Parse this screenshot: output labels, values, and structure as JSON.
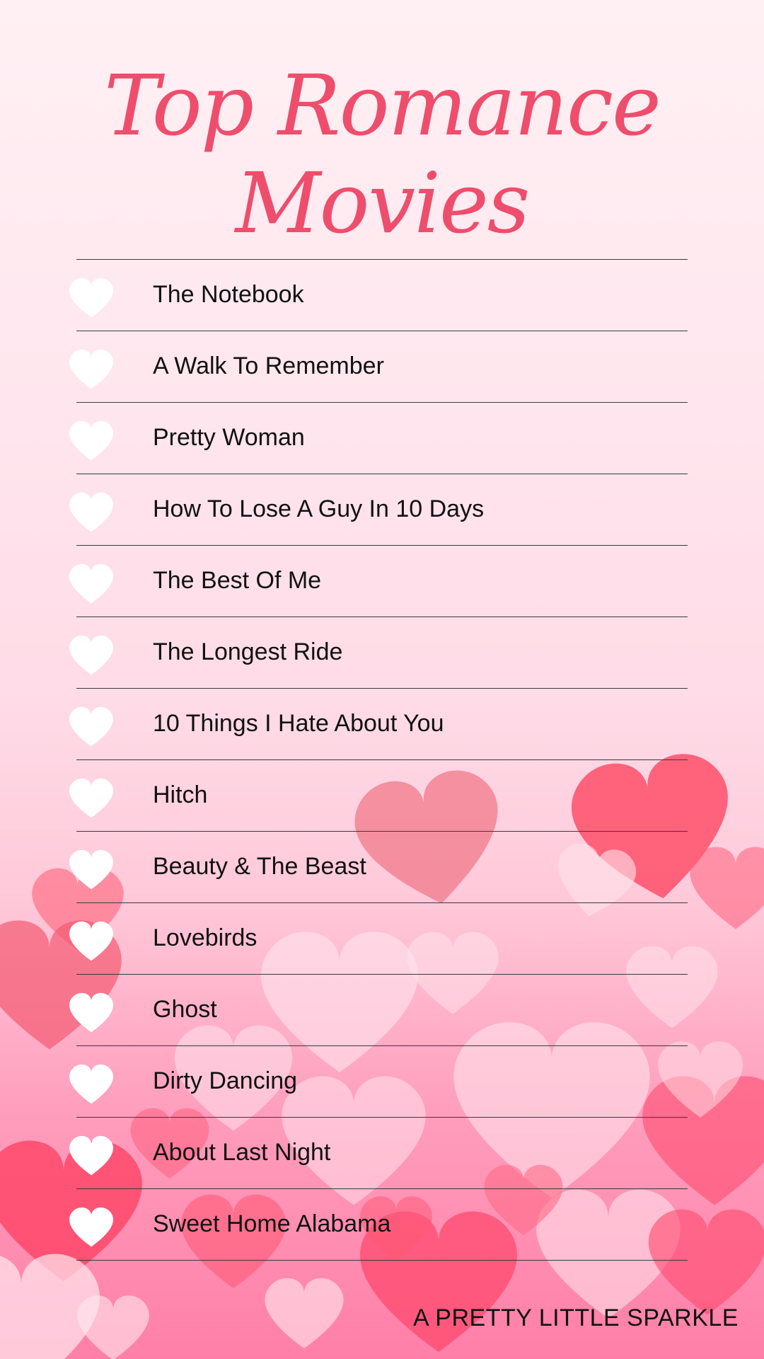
{
  "title": "Top Romance Movies",
  "movies": [
    {
      "label": "The Notebook"
    },
    {
      "label": "A Walk To Remember"
    },
    {
      "label": "Pretty Woman"
    },
    {
      "label": "How To Lose A Guy In 10 Days"
    },
    {
      "label": "The Best Of Me"
    },
    {
      "label": "The Longest Ride"
    },
    {
      "label": "10 Things I Hate About You"
    },
    {
      "label": "Hitch"
    },
    {
      "label": "Beauty & The Beast"
    },
    {
      "label": "Lovebirds"
    },
    {
      "label": "Ghost"
    },
    {
      "label": "Dirty Dancing"
    },
    {
      "label": "About Last Night"
    },
    {
      "label": "Sweet Home Alabama"
    }
  ],
  "footer": "A PRETTY LITTLE SPARKLE",
  "colors": {
    "title": "#ee4d6c",
    "heart_icon": "#ffffff",
    "divider": "#3a3a3a"
  },
  "icons": {
    "row_marker": "heart-icon",
    "background": "heart-icon"
  }
}
